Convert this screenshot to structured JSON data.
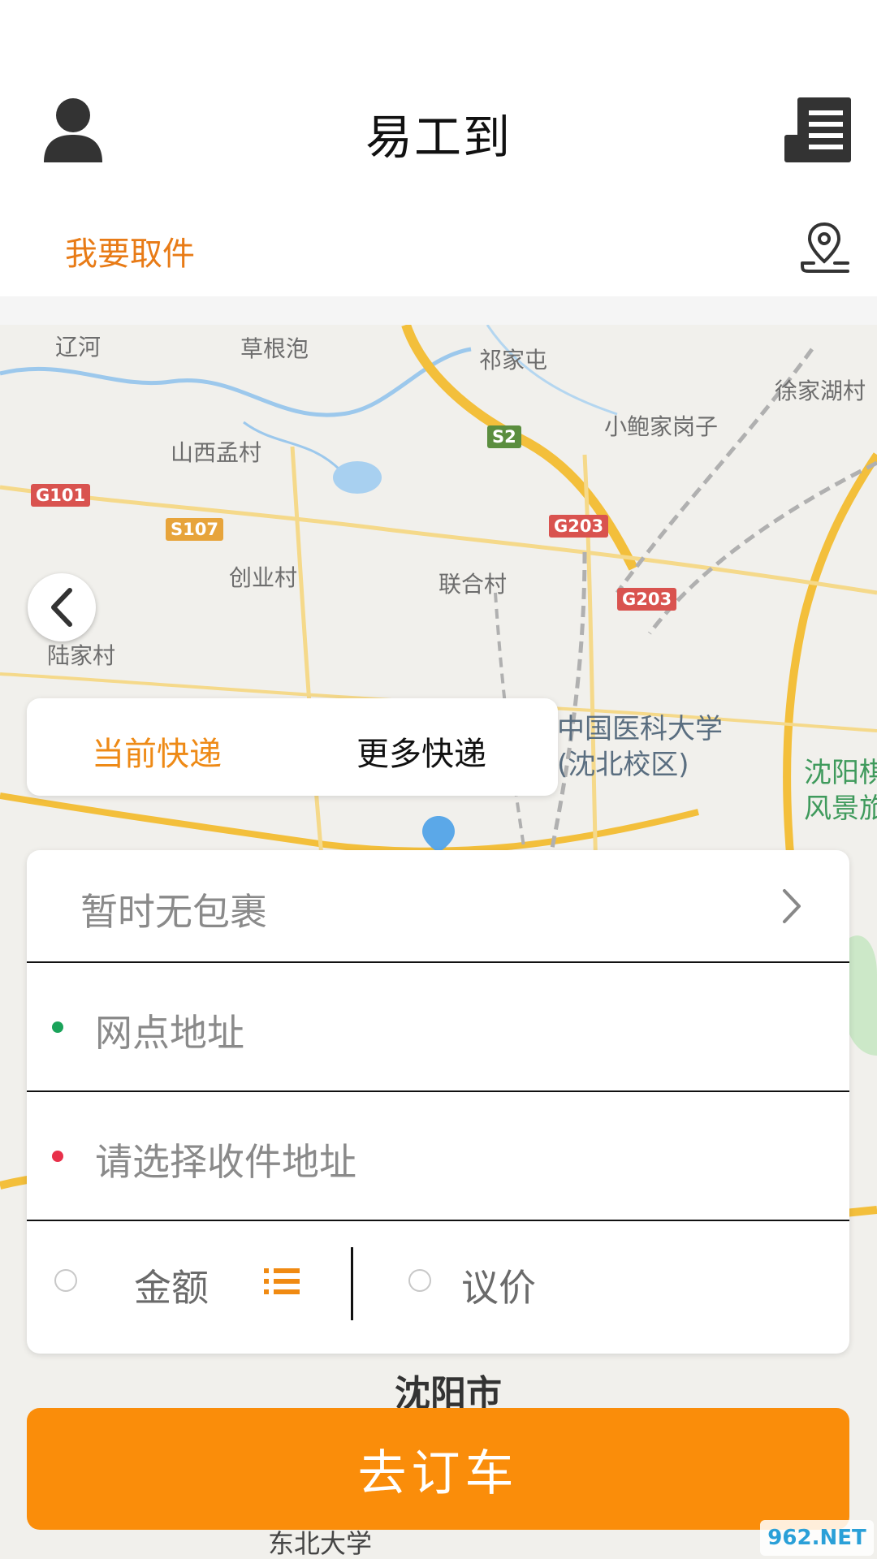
{
  "header": {
    "title": "易工到",
    "pickup_label": "我要取件"
  },
  "map": {
    "labels": {
      "liaohe": "辽河",
      "caogenpao": "草根泡",
      "qijiatun": "祁家屯",
      "xujiahucun": "徐家湖村",
      "xiaobaojiagangzi": "小鲍家岗子",
      "shanximengcun": "山西孟村",
      "chuangyecun": "创业村",
      "lianhecun": "联合村",
      "lujiacun": "陆家村",
      "cmu_line1": "中国医科大学",
      "cmu_line2": "(沈北校区)",
      "scenic_line1": "沈阳棋",
      "scenic_line2": "风景旅",
      "shenyang": "沈阳市",
      "neu": "东北大学"
    },
    "shields": {
      "s2": "S2",
      "g101": "G101",
      "s107": "S107",
      "g203a": "G203",
      "g203b": "G203"
    }
  },
  "tabs": {
    "current": "当前快递",
    "more": "更多快递"
  },
  "form": {
    "package_status": "暂时无包裹",
    "outlet_placeholder": "网点地址",
    "receive_placeholder": "请选择收件地址",
    "amount_label": "金额",
    "negotiate_label": "议价"
  },
  "actions": {
    "order_button": "去订车"
  },
  "watermark": "962.NET",
  "colors": {
    "accent_orange": "#fa8d0a",
    "tab_active": "#ee8a16",
    "dot_green": "#1aa35a",
    "dot_red": "#e8304a"
  }
}
